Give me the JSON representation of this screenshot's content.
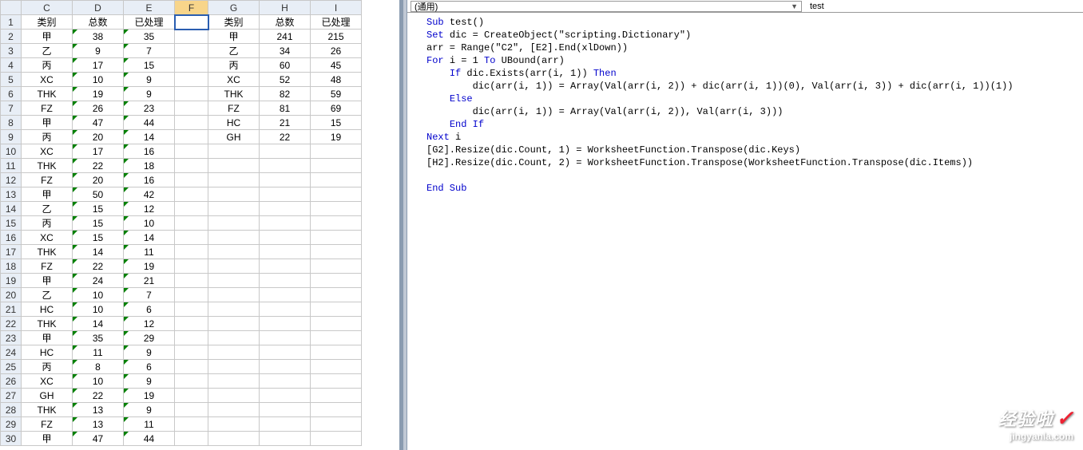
{
  "sheet": {
    "columns": [
      "C",
      "D",
      "E",
      "F",
      "G",
      "H",
      "I"
    ],
    "header_row": {
      "C": "类别",
      "D": "总数",
      "E": "已处理",
      "F": "",
      "G": "类别",
      "H": "总数",
      "I": "已处理"
    },
    "rows": [
      {
        "n": 2,
        "C": "甲",
        "D": "38",
        "E": "35",
        "G": "甲",
        "H": "241",
        "I": "215"
      },
      {
        "n": 3,
        "C": "乙",
        "D": "9",
        "E": "7",
        "G": "乙",
        "H": "34",
        "I": "26"
      },
      {
        "n": 4,
        "C": "丙",
        "D": "17",
        "E": "15",
        "G": "丙",
        "H": "60",
        "I": "45"
      },
      {
        "n": 5,
        "C": "XC",
        "D": "10",
        "E": "9",
        "G": "XC",
        "H": "52",
        "I": "48"
      },
      {
        "n": 6,
        "C": "THK",
        "D": "19",
        "E": "9",
        "G": "THK",
        "H": "82",
        "I": "59"
      },
      {
        "n": 7,
        "C": "FZ",
        "D": "26",
        "E": "23",
        "G": "FZ",
        "H": "81",
        "I": "69"
      },
      {
        "n": 8,
        "C": "甲",
        "D": "47",
        "E": "44",
        "G": "HC",
        "H": "21",
        "I": "15"
      },
      {
        "n": 9,
        "C": "丙",
        "D": "20",
        "E": "14",
        "G": "GH",
        "H": "22",
        "I": "19"
      },
      {
        "n": 10,
        "C": "XC",
        "D": "17",
        "E": "16"
      },
      {
        "n": 11,
        "C": "THK",
        "D": "22",
        "E": "18"
      },
      {
        "n": 12,
        "C": "FZ",
        "D": "20",
        "E": "16"
      },
      {
        "n": 13,
        "C": "甲",
        "D": "50",
        "E": "42"
      },
      {
        "n": 14,
        "C": "乙",
        "D": "15",
        "E": "12"
      },
      {
        "n": 15,
        "C": "丙",
        "D": "15",
        "E": "10"
      },
      {
        "n": 16,
        "C": "XC",
        "D": "15",
        "E": "14"
      },
      {
        "n": 17,
        "C": "THK",
        "D": "14",
        "E": "11"
      },
      {
        "n": 18,
        "C": "FZ",
        "D": "22",
        "E": "19"
      },
      {
        "n": 19,
        "C": "甲",
        "D": "24",
        "E": "21"
      },
      {
        "n": 20,
        "C": "乙",
        "D": "10",
        "E": "7"
      },
      {
        "n": 21,
        "C": "HC",
        "D": "10",
        "E": "6"
      },
      {
        "n": 22,
        "C": "THK",
        "D": "14",
        "E": "12"
      },
      {
        "n": 23,
        "C": "甲",
        "D": "35",
        "E": "29"
      },
      {
        "n": 24,
        "C": "HC",
        "D": "11",
        "E": "9"
      },
      {
        "n": 25,
        "C": "丙",
        "D": "8",
        "E": "6"
      },
      {
        "n": 26,
        "C": "XC",
        "D": "10",
        "E": "9"
      },
      {
        "n": 27,
        "C": "GH",
        "D": "22",
        "E": "19"
      },
      {
        "n": 28,
        "C": "THK",
        "D": "13",
        "E": "9"
      },
      {
        "n": 29,
        "C": "FZ",
        "D": "13",
        "E": "11"
      },
      {
        "n": 30,
        "C": "甲",
        "D": "47",
        "E": "44"
      }
    ],
    "selected_cell": "F1"
  },
  "editor": {
    "scope_dropdown": "(通用)",
    "proc_dropdown": "test",
    "code_lines": [
      {
        "t": "plain",
        "parts": [
          {
            "c": "kw",
            "s": "Sub "
          },
          {
            "c": "",
            "s": "test()"
          }
        ]
      },
      {
        "t": "plain",
        "parts": [
          {
            "c": "kw",
            "s": "Set "
          },
          {
            "c": "",
            "s": "dic = CreateObject(\"scripting.Dictionary\")"
          }
        ]
      },
      {
        "t": "plain",
        "parts": [
          {
            "c": "",
            "s": "arr = Range(\"C2\", [E2].End(xlDown))"
          }
        ]
      },
      {
        "t": "plain",
        "parts": [
          {
            "c": "kw",
            "s": "For "
          },
          {
            "c": "",
            "s": "i = 1 "
          },
          {
            "c": "kw",
            "s": "To "
          },
          {
            "c": "",
            "s": "UBound(arr)"
          }
        ]
      },
      {
        "t": "plain",
        "parts": [
          {
            "c": "",
            "s": "    "
          },
          {
            "c": "kw",
            "s": "If "
          },
          {
            "c": "",
            "s": "dic.Exists(arr(i, 1)) "
          },
          {
            "c": "kw",
            "s": "Then"
          }
        ]
      },
      {
        "t": "plain",
        "parts": [
          {
            "c": "",
            "s": "        dic(arr(i, 1)) = Array(Val(arr(i, 2)) + dic(arr(i, 1))(0), Val(arr(i, 3)) + dic(arr(i, 1))(1))"
          }
        ]
      },
      {
        "t": "plain",
        "parts": [
          {
            "c": "",
            "s": "    "
          },
          {
            "c": "kw",
            "s": "Else"
          }
        ]
      },
      {
        "t": "plain",
        "parts": [
          {
            "c": "",
            "s": "        dic(arr(i, 1)) = Array(Val(arr(i, 2)), Val(arr(i, 3)))"
          }
        ]
      },
      {
        "t": "plain",
        "parts": [
          {
            "c": "",
            "s": "    "
          },
          {
            "c": "kw",
            "s": "End If"
          }
        ]
      },
      {
        "t": "plain",
        "parts": [
          {
            "c": "kw",
            "s": "Next "
          },
          {
            "c": "",
            "s": "i"
          }
        ]
      },
      {
        "t": "plain",
        "parts": [
          {
            "c": "",
            "s": "[G2].Resize(dic.Count, 1) = WorksheetFunction.Transpose(dic.Keys)"
          }
        ]
      },
      {
        "t": "plain",
        "parts": [
          {
            "c": "",
            "s": "[H2].Resize(dic.Count, 2) = WorksheetFunction.Transpose(WorksheetFunction.Transpose(dic.Items))"
          }
        ]
      },
      {
        "t": "blank"
      },
      {
        "t": "plain",
        "parts": [
          {
            "c": "kw",
            "s": "End Sub"
          }
        ]
      }
    ]
  },
  "watermark": {
    "big": "经验啦",
    "small": "jingyanla.com"
  }
}
